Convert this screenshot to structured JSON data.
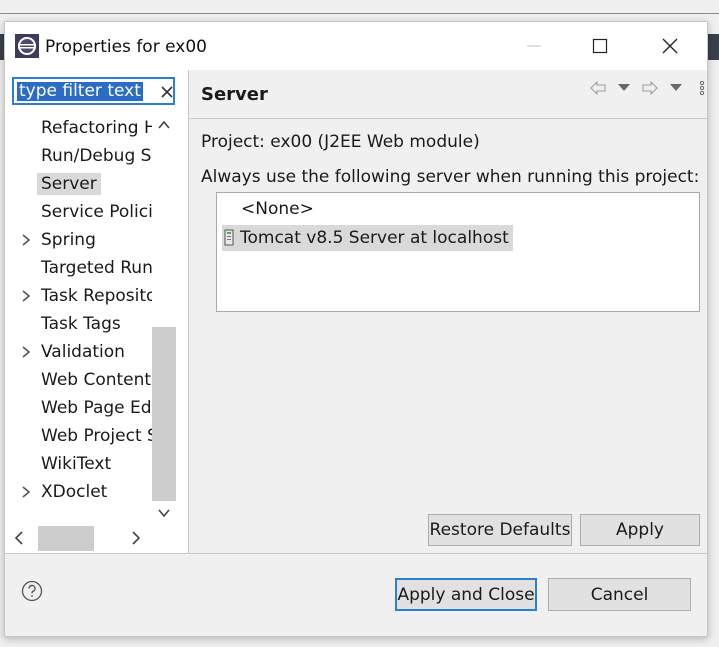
{
  "window": {
    "title": "Properties for ex00"
  },
  "filter": {
    "text": "type filter text"
  },
  "tree": {
    "items": [
      {
        "label": "Refactoring H",
        "expandable": false,
        "selected": false
      },
      {
        "label": "Run/Debug Se",
        "expandable": false,
        "selected": false
      },
      {
        "label": "Server",
        "expandable": false,
        "selected": true
      },
      {
        "label": "Service Policie",
        "expandable": false,
        "selected": false
      },
      {
        "label": "Spring",
        "expandable": true,
        "selected": false
      },
      {
        "label": "Targeted Run",
        "expandable": false,
        "selected": false
      },
      {
        "label": "Task Reposito",
        "expandable": true,
        "selected": false
      },
      {
        "label": "Task Tags",
        "expandable": false,
        "selected": false
      },
      {
        "label": "Validation",
        "expandable": true,
        "selected": false
      },
      {
        "label": "Web Content",
        "expandable": false,
        "selected": false
      },
      {
        "label": "Web Page Ed",
        "expandable": false,
        "selected": false
      },
      {
        "label": "Web Project S",
        "expandable": false,
        "selected": false
      },
      {
        "label": "WikiText",
        "expandable": false,
        "selected": false
      },
      {
        "label": "XDoclet",
        "expandable": true,
        "selected": false
      }
    ]
  },
  "page": {
    "title": "Server",
    "project": "Project: ex00 (J2EE Web module)",
    "server_label": "Always use the following server when running this project:",
    "servers": [
      "<None>",
      "Tomcat v8.5 Server at localhost"
    ],
    "selected_server": "Tomcat v8.5 Server at localhost"
  },
  "buttons": {
    "restore": "Restore Defaults",
    "apply": "Apply",
    "apply_close": "Apply and Close",
    "cancel": "Cancel"
  },
  "colors": {
    "accent": "#2a7fd6",
    "selection": "#d9d9d9"
  }
}
